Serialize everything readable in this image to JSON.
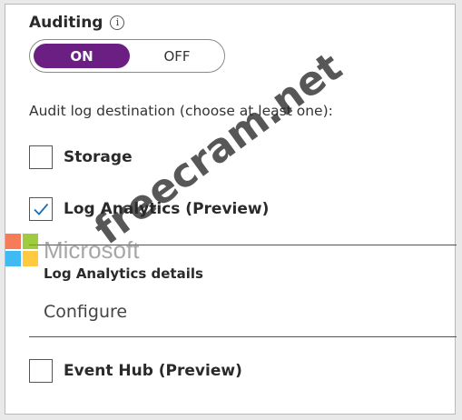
{
  "auditing": {
    "label": "Auditing",
    "info_icon": "info-icon",
    "toggle": {
      "on_label": "ON",
      "off_label": "OFF",
      "selected": "ON",
      "accent_color": "#6b1f82"
    }
  },
  "destination": {
    "label": "Audit log destination (choose at least one):",
    "options": [
      {
        "label": "Storage",
        "checked": false
      },
      {
        "label": "Log Analytics (Preview)",
        "checked": true
      },
      {
        "label": "Event Hub (Preview)",
        "checked": false
      }
    ]
  },
  "log_analytics_details": {
    "title": "Log Analytics details",
    "configure_label": "Configure"
  },
  "overlays": {
    "logo_text": "Microsoft",
    "watermark_text": "freecram.net"
  }
}
